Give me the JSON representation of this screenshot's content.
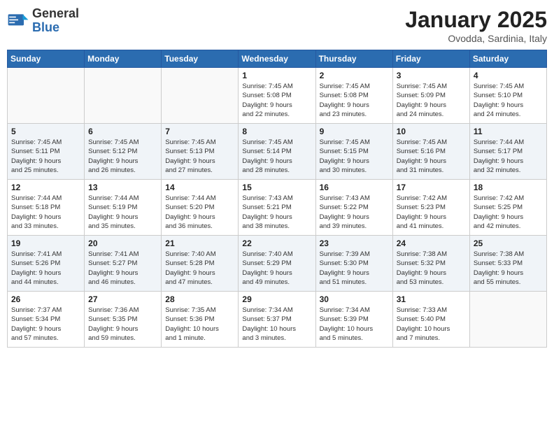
{
  "logo": {
    "general": "General",
    "blue": "Blue"
  },
  "title": "January 2025",
  "subtitle": "Ovodda, Sardinia, Italy",
  "weekdays": [
    "Sunday",
    "Monday",
    "Tuesday",
    "Wednesday",
    "Thursday",
    "Friday",
    "Saturday"
  ],
  "weeks": [
    [
      {
        "day": "",
        "info": ""
      },
      {
        "day": "",
        "info": ""
      },
      {
        "day": "",
        "info": ""
      },
      {
        "day": "1",
        "info": "Sunrise: 7:45 AM\nSunset: 5:08 PM\nDaylight: 9 hours\nand 22 minutes."
      },
      {
        "day": "2",
        "info": "Sunrise: 7:45 AM\nSunset: 5:08 PM\nDaylight: 9 hours\nand 23 minutes."
      },
      {
        "day": "3",
        "info": "Sunrise: 7:45 AM\nSunset: 5:09 PM\nDaylight: 9 hours\nand 24 minutes."
      },
      {
        "day": "4",
        "info": "Sunrise: 7:45 AM\nSunset: 5:10 PM\nDaylight: 9 hours\nand 24 minutes."
      }
    ],
    [
      {
        "day": "5",
        "info": "Sunrise: 7:45 AM\nSunset: 5:11 PM\nDaylight: 9 hours\nand 25 minutes."
      },
      {
        "day": "6",
        "info": "Sunrise: 7:45 AM\nSunset: 5:12 PM\nDaylight: 9 hours\nand 26 minutes."
      },
      {
        "day": "7",
        "info": "Sunrise: 7:45 AM\nSunset: 5:13 PM\nDaylight: 9 hours\nand 27 minutes."
      },
      {
        "day": "8",
        "info": "Sunrise: 7:45 AM\nSunset: 5:14 PM\nDaylight: 9 hours\nand 28 minutes."
      },
      {
        "day": "9",
        "info": "Sunrise: 7:45 AM\nSunset: 5:15 PM\nDaylight: 9 hours\nand 30 minutes."
      },
      {
        "day": "10",
        "info": "Sunrise: 7:45 AM\nSunset: 5:16 PM\nDaylight: 9 hours\nand 31 minutes."
      },
      {
        "day": "11",
        "info": "Sunrise: 7:44 AM\nSunset: 5:17 PM\nDaylight: 9 hours\nand 32 minutes."
      }
    ],
    [
      {
        "day": "12",
        "info": "Sunrise: 7:44 AM\nSunset: 5:18 PM\nDaylight: 9 hours\nand 33 minutes."
      },
      {
        "day": "13",
        "info": "Sunrise: 7:44 AM\nSunset: 5:19 PM\nDaylight: 9 hours\nand 35 minutes."
      },
      {
        "day": "14",
        "info": "Sunrise: 7:44 AM\nSunset: 5:20 PM\nDaylight: 9 hours\nand 36 minutes."
      },
      {
        "day": "15",
        "info": "Sunrise: 7:43 AM\nSunset: 5:21 PM\nDaylight: 9 hours\nand 38 minutes."
      },
      {
        "day": "16",
        "info": "Sunrise: 7:43 AM\nSunset: 5:22 PM\nDaylight: 9 hours\nand 39 minutes."
      },
      {
        "day": "17",
        "info": "Sunrise: 7:42 AM\nSunset: 5:23 PM\nDaylight: 9 hours\nand 41 minutes."
      },
      {
        "day": "18",
        "info": "Sunrise: 7:42 AM\nSunset: 5:25 PM\nDaylight: 9 hours\nand 42 minutes."
      }
    ],
    [
      {
        "day": "19",
        "info": "Sunrise: 7:41 AM\nSunset: 5:26 PM\nDaylight: 9 hours\nand 44 minutes."
      },
      {
        "day": "20",
        "info": "Sunrise: 7:41 AM\nSunset: 5:27 PM\nDaylight: 9 hours\nand 46 minutes."
      },
      {
        "day": "21",
        "info": "Sunrise: 7:40 AM\nSunset: 5:28 PM\nDaylight: 9 hours\nand 47 minutes."
      },
      {
        "day": "22",
        "info": "Sunrise: 7:40 AM\nSunset: 5:29 PM\nDaylight: 9 hours\nand 49 minutes."
      },
      {
        "day": "23",
        "info": "Sunrise: 7:39 AM\nSunset: 5:30 PM\nDaylight: 9 hours\nand 51 minutes."
      },
      {
        "day": "24",
        "info": "Sunrise: 7:38 AM\nSunset: 5:32 PM\nDaylight: 9 hours\nand 53 minutes."
      },
      {
        "day": "25",
        "info": "Sunrise: 7:38 AM\nSunset: 5:33 PM\nDaylight: 9 hours\nand 55 minutes."
      }
    ],
    [
      {
        "day": "26",
        "info": "Sunrise: 7:37 AM\nSunset: 5:34 PM\nDaylight: 9 hours\nand 57 minutes."
      },
      {
        "day": "27",
        "info": "Sunrise: 7:36 AM\nSunset: 5:35 PM\nDaylight: 9 hours\nand 59 minutes."
      },
      {
        "day": "28",
        "info": "Sunrise: 7:35 AM\nSunset: 5:36 PM\nDaylight: 10 hours\nand 1 minute."
      },
      {
        "day": "29",
        "info": "Sunrise: 7:34 AM\nSunset: 5:37 PM\nDaylight: 10 hours\nand 3 minutes."
      },
      {
        "day": "30",
        "info": "Sunrise: 7:34 AM\nSunset: 5:39 PM\nDaylight: 10 hours\nand 5 minutes."
      },
      {
        "day": "31",
        "info": "Sunrise: 7:33 AM\nSunset: 5:40 PM\nDaylight: 10 hours\nand 7 minutes."
      },
      {
        "day": "",
        "info": ""
      }
    ]
  ]
}
